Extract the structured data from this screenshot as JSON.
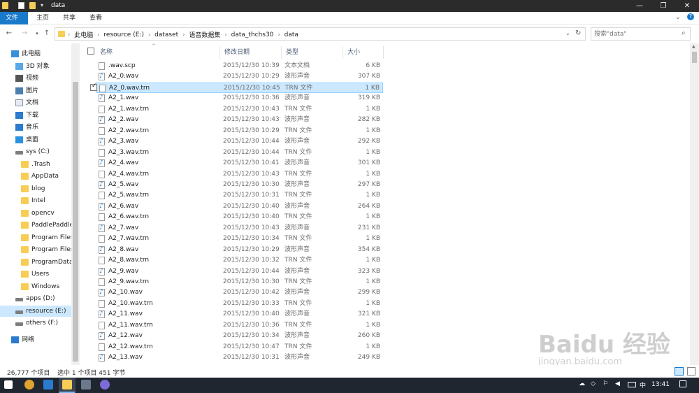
{
  "window": {
    "title": "data"
  },
  "ribbon": {
    "tabs": [
      "文件",
      "主页",
      "共享",
      "查看"
    ]
  },
  "address": {
    "crumbs": [
      "此电脑",
      "resource (E:)",
      "dataset",
      "语音数据集",
      "data_thchs30",
      "data"
    ]
  },
  "search": {
    "placeholder": "搜索\"data\""
  },
  "sidebar": {
    "items": [
      {
        "label": "此电脑",
        "icon": "computer-icon"
      },
      {
        "label": "3D 对象",
        "icon": "cube-icon"
      },
      {
        "label": "视频",
        "icon": "video-icon"
      },
      {
        "label": "图片",
        "icon": "picture-icon"
      },
      {
        "label": "文档",
        "icon": "document-icon"
      },
      {
        "label": "下载",
        "icon": "download-icon"
      },
      {
        "label": "音乐",
        "icon": "music-icon"
      },
      {
        "label": "桌面",
        "icon": "desktop-icon"
      },
      {
        "label": "sys (C:)",
        "icon": "drive-icon"
      },
      {
        "label": ".Trash",
        "icon": "folder-icon"
      },
      {
        "label": "AppData",
        "icon": "folder-icon"
      },
      {
        "label": "blog",
        "icon": "folder-icon"
      },
      {
        "label": "Intel",
        "icon": "folder-icon"
      },
      {
        "label": "opencv",
        "icon": "folder-icon"
      },
      {
        "label": "PaddlePaddle",
        "icon": "folder-icon"
      },
      {
        "label": "Program Files",
        "icon": "folder-icon"
      },
      {
        "label": "Program Files",
        "icon": "folder-icon"
      },
      {
        "label": "ProgramData",
        "icon": "folder-icon"
      },
      {
        "label": "Users",
        "icon": "folder-icon"
      },
      {
        "label": "Windows",
        "icon": "folder-icon"
      },
      {
        "label": "apps (D:)",
        "icon": "drive-icon"
      },
      {
        "label": "resource (E:)",
        "icon": "drive-icon",
        "selected": true
      },
      {
        "label": "others (F:)",
        "icon": "drive-icon"
      },
      {
        "label": "网络",
        "icon": "network-icon"
      }
    ]
  },
  "columns": {
    "name": "名称",
    "date": "修改日期",
    "type": "类型",
    "size": "大小"
  },
  "files": [
    {
      "name": ".wav.scp",
      "date": "2015/12/30 10:39",
      "type": "文本文档",
      "size": "6 KB",
      "kind": "doc"
    },
    {
      "name": "A2_0.wav",
      "date": "2015/12/30 10:29",
      "type": "波形声音",
      "size": "307 KB",
      "kind": "wav"
    },
    {
      "name": "A2_0.wav.trn",
      "date": "2015/12/30 10:45",
      "type": "TRN 文件",
      "size": "1 KB",
      "kind": "doc",
      "selected": true
    },
    {
      "name": "A2_1.wav",
      "date": "2015/12/30 10:36",
      "type": "波形声音",
      "size": "319 KB",
      "kind": "wav"
    },
    {
      "name": "A2_1.wav.trn",
      "date": "2015/12/30 10:43",
      "type": "TRN 文件",
      "size": "1 KB",
      "kind": "doc"
    },
    {
      "name": "A2_2.wav",
      "date": "2015/12/30 10:43",
      "type": "波形声音",
      "size": "282 KB",
      "kind": "wav"
    },
    {
      "name": "A2_2.wav.trn",
      "date": "2015/12/30 10:29",
      "type": "TRN 文件",
      "size": "1 KB",
      "kind": "doc"
    },
    {
      "name": "A2_3.wav",
      "date": "2015/12/30 10:44",
      "type": "波形声音",
      "size": "292 KB",
      "kind": "wav"
    },
    {
      "name": "A2_3.wav.trn",
      "date": "2015/12/30 10:44",
      "type": "TRN 文件",
      "size": "1 KB",
      "kind": "doc"
    },
    {
      "name": "A2_4.wav",
      "date": "2015/12/30 10:41",
      "type": "波形声音",
      "size": "301 KB",
      "kind": "wav"
    },
    {
      "name": "A2_4.wav.trn",
      "date": "2015/12/30 10:43",
      "type": "TRN 文件",
      "size": "1 KB",
      "kind": "doc"
    },
    {
      "name": "A2_5.wav",
      "date": "2015/12/30 10:30",
      "type": "波形声音",
      "size": "297 KB",
      "kind": "wav"
    },
    {
      "name": "A2_5.wav.trn",
      "date": "2015/12/30 10:31",
      "type": "TRN 文件",
      "size": "1 KB",
      "kind": "doc"
    },
    {
      "name": "A2_6.wav",
      "date": "2015/12/30 10:40",
      "type": "波形声音",
      "size": "264 KB",
      "kind": "wav"
    },
    {
      "name": "A2_6.wav.trn",
      "date": "2015/12/30 10:40",
      "type": "TRN 文件",
      "size": "1 KB",
      "kind": "doc"
    },
    {
      "name": "A2_7.wav",
      "date": "2015/12/30 10:43",
      "type": "波形声音",
      "size": "231 KB",
      "kind": "wav"
    },
    {
      "name": "A2_7.wav.trn",
      "date": "2015/12/30 10:34",
      "type": "TRN 文件",
      "size": "1 KB",
      "kind": "doc"
    },
    {
      "name": "A2_8.wav",
      "date": "2015/12/30 10:29",
      "type": "波形声音",
      "size": "354 KB",
      "kind": "wav"
    },
    {
      "name": "A2_8.wav.trn",
      "date": "2015/12/30 10:32",
      "type": "TRN 文件",
      "size": "1 KB",
      "kind": "doc"
    },
    {
      "name": "A2_9.wav",
      "date": "2015/12/30 10:44",
      "type": "波形声音",
      "size": "323 KB",
      "kind": "wav"
    },
    {
      "name": "A2_9.wav.trn",
      "date": "2015/12/30 10:30",
      "type": "TRN 文件",
      "size": "1 KB",
      "kind": "doc"
    },
    {
      "name": "A2_10.wav",
      "date": "2015/12/30 10:42",
      "type": "波形声音",
      "size": "299 KB",
      "kind": "wav"
    },
    {
      "name": "A2_10.wav.trn",
      "date": "2015/12/30 10:33",
      "type": "TRN 文件",
      "size": "1 KB",
      "kind": "doc"
    },
    {
      "name": "A2_11.wav",
      "date": "2015/12/30 10:40",
      "type": "波形声音",
      "size": "321 KB",
      "kind": "wav"
    },
    {
      "name": "A2_11.wav.trn",
      "date": "2015/12/30 10:36",
      "type": "TRN 文件",
      "size": "1 KB",
      "kind": "doc"
    },
    {
      "name": "A2_12.wav",
      "date": "2015/12/30 10:34",
      "type": "波形声音",
      "size": "260 KB",
      "kind": "wav"
    },
    {
      "name": "A2_12.wav.trn",
      "date": "2015/12/30 10:47",
      "type": "TRN 文件",
      "size": "1 KB",
      "kind": "doc"
    },
    {
      "name": "A2_13.wav",
      "date": "2015/12/30 10:31",
      "type": "波形声音",
      "size": "249 KB",
      "kind": "wav"
    }
  ],
  "status": {
    "count": "26,777 个项目",
    "selection": "选中 1 个项目  451 字节"
  },
  "taskbar": {
    "time": "13:41"
  },
  "watermark": {
    "brand": "Baidu 经验",
    "url": "jingyan.baidu.com"
  },
  "colors": {
    "accent": "#1979ca",
    "selection": "#cce8ff",
    "folder": "#f7cd56",
    "taskbar": "#1f2630"
  }
}
